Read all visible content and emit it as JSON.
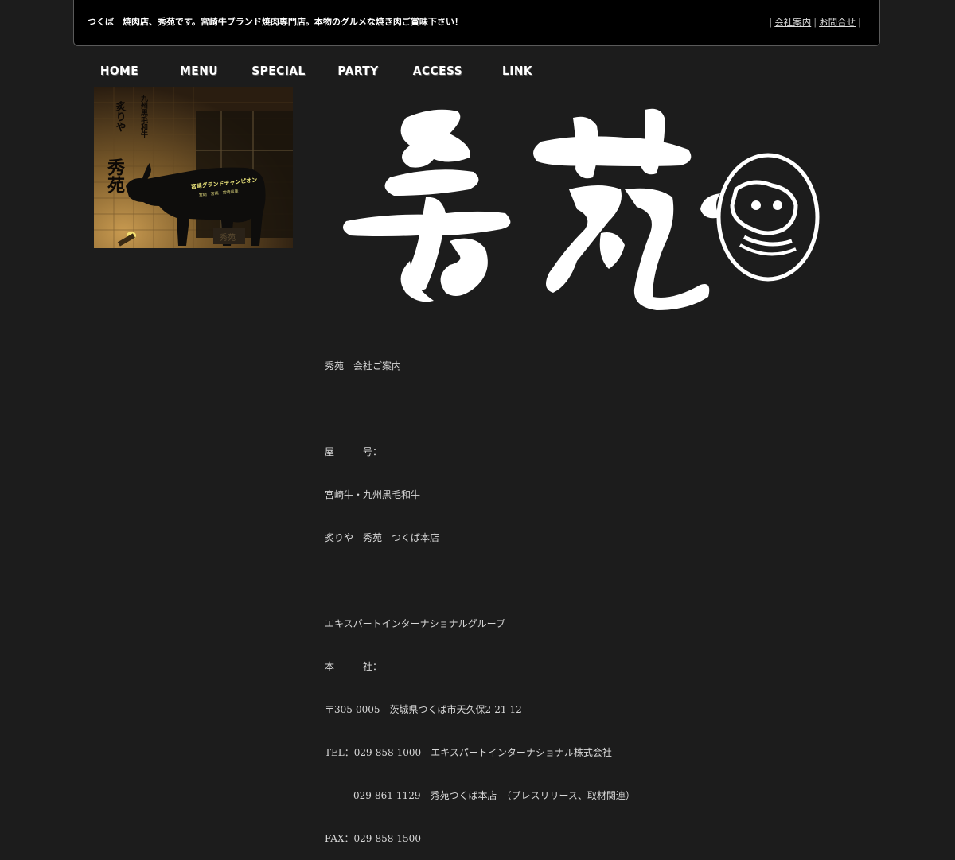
{
  "header": {
    "tagline": "つくば　焼肉店、秀苑です。宮崎牛ブランド焼肉専門店。本物のグルメな焼き肉ご賞味下さい！",
    "links": [
      {
        "label": "会社案内"
      },
      {
        "label": "お問合せ"
      }
    ]
  },
  "nav": {
    "items": [
      {
        "label": "HOME"
      },
      {
        "label": "MENU"
      },
      {
        "label": "SPECIAL"
      },
      {
        "label": "PARTY"
      },
      {
        "label": "ACCESS"
      },
      {
        "label": "LINK"
      }
    ]
  },
  "photo": {
    "sign_text": "宮崎グランドチャンピオン",
    "sign_sub": "宮崎　宮崎　宮崎県産",
    "wall_text_left": "九州黒毛和牛",
    "wall_text_mid": "炙りや",
    "wall_text_bottom": "秀苑",
    "plaque": "秀苑"
  },
  "company": {
    "title": "秀苑　会社ご案内",
    "trade_name_label": "屋　　　号：",
    "trade_name_1": "宮崎牛・九州黒毛和牛",
    "trade_name_2": "炙りや　秀苑　つくば本店",
    "group": "エキスパートインターナショナルグループ",
    "hq_label": "本　　　社：",
    "postal": "〒305-0005　茨城県つくば市天久保2-21-12",
    "tel1": "TEL：029-858-1000　エキスパートインターナショナル株式会社",
    "tel2": "029-861-1129　秀苑つくば本店　（プレスリリース、取材関連）",
    "fax": "FAX：029-858-1500"
  }
}
